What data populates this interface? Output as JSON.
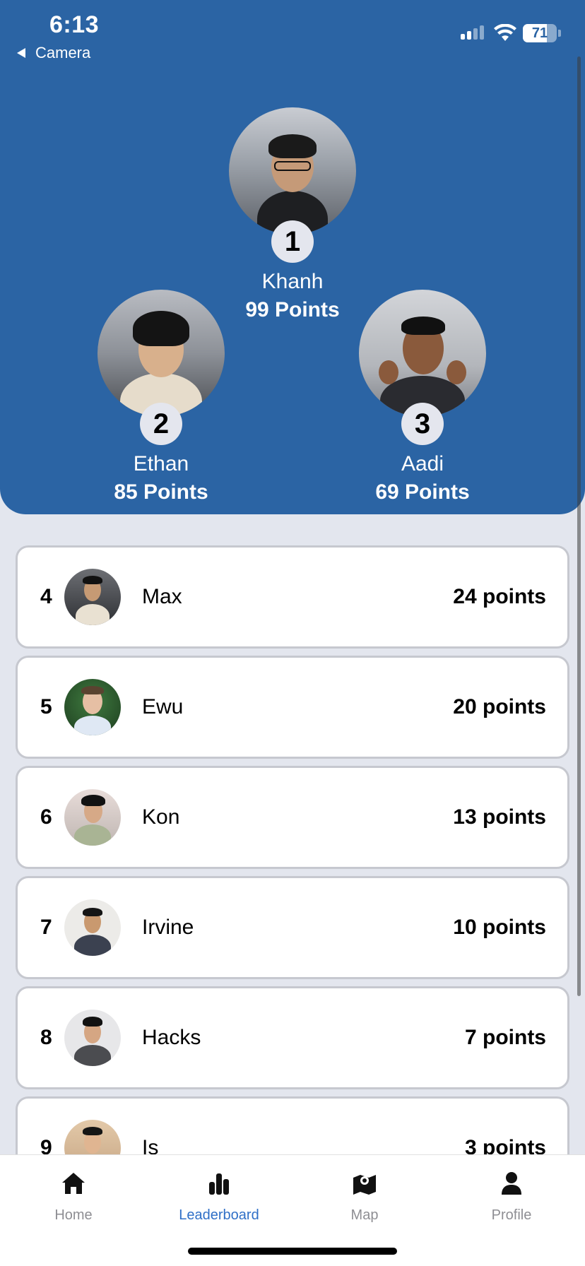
{
  "status_bar": {
    "time": "6:13",
    "back_label": "Camera",
    "battery": "71"
  },
  "podium": [
    {
      "rank": "1",
      "name": "Khanh",
      "points": "99 Points"
    },
    {
      "rank": "2",
      "name": "Ethan",
      "points": "85 Points"
    },
    {
      "rank": "3",
      "name": "Aadi",
      "points": "69 Points"
    }
  ],
  "leaderboard": [
    {
      "rank": "4",
      "name": "Max",
      "points": "24 points"
    },
    {
      "rank": "5",
      "name": "Ewu",
      "points": "20 points"
    },
    {
      "rank": "6",
      "name": "Kon",
      "points": "13 points"
    },
    {
      "rank": "7",
      "name": "Irvine",
      "points": "10 points"
    },
    {
      "rank": "8",
      "name": "Hacks",
      "points": "7 points"
    },
    {
      "rank": "9",
      "name": "Is",
      "points": "3 points"
    }
  ],
  "tabs": [
    {
      "label": "Home",
      "icon": "home-icon",
      "active": false
    },
    {
      "label": "Leaderboard",
      "icon": "bar-chart-icon",
      "active": true
    },
    {
      "label": "Map",
      "icon": "map-icon",
      "active": false
    },
    {
      "label": "Profile",
      "icon": "person-icon",
      "active": false
    }
  ],
  "colors": {
    "header_bg": "#2b64a4",
    "page_bg": "#e3e6ee",
    "active_tab": "#2f6fc7",
    "inactive_tab": "#8e8e93"
  }
}
